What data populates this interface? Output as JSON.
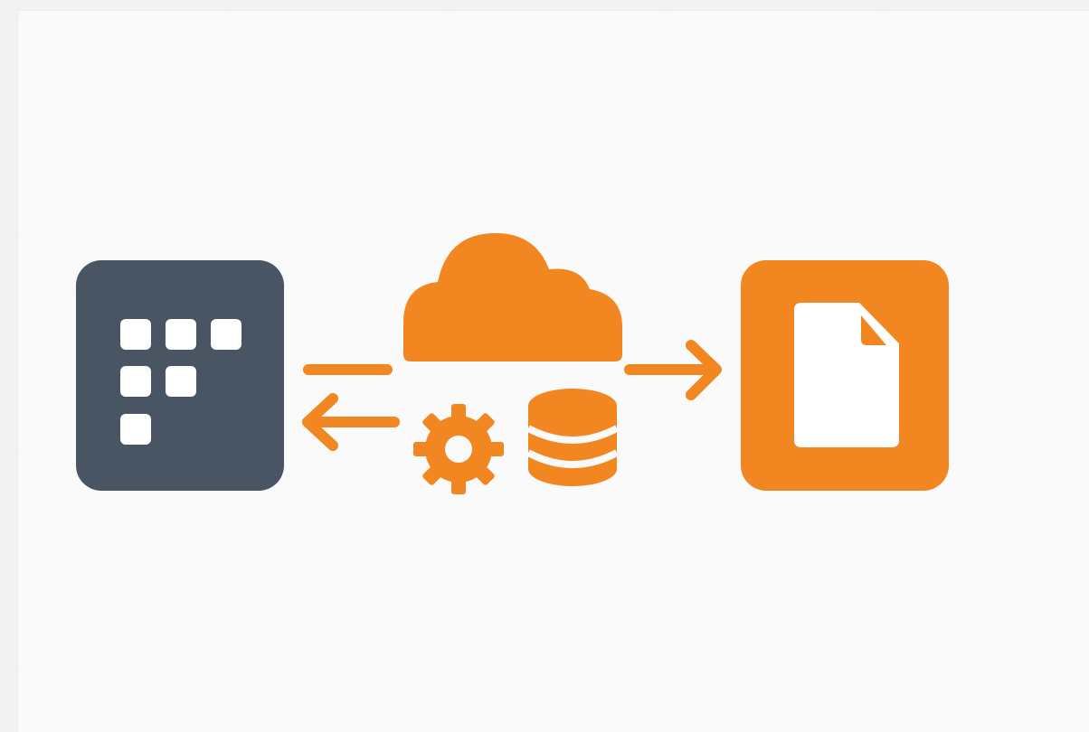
{
  "diagram": {
    "colors": {
      "background": "#fafafa",
      "frame": "#f2f2f2",
      "slate": "#4a5563",
      "orange": "#f28621",
      "white": "#ffffff"
    },
    "nodes": [
      {
        "id": "source-app",
        "icon": "grid-app-icon",
        "color": "#4a5563"
      },
      {
        "id": "cloud",
        "icon": "cloud-icon",
        "color": "#f28621"
      },
      {
        "id": "gear",
        "icon": "gear-icon",
        "color": "#f28621"
      },
      {
        "id": "database",
        "icon": "database-icon",
        "color": "#f28621"
      },
      {
        "id": "target-document",
        "icon": "document-icon",
        "color": "#f28621"
      }
    ],
    "edges": [
      {
        "from": "source-app",
        "to": "cloud",
        "style": "line"
      },
      {
        "from": "cloud",
        "to": "source-app",
        "style": "arrow"
      },
      {
        "from": "cloud",
        "to": "target-document",
        "style": "arrow"
      }
    ]
  }
}
